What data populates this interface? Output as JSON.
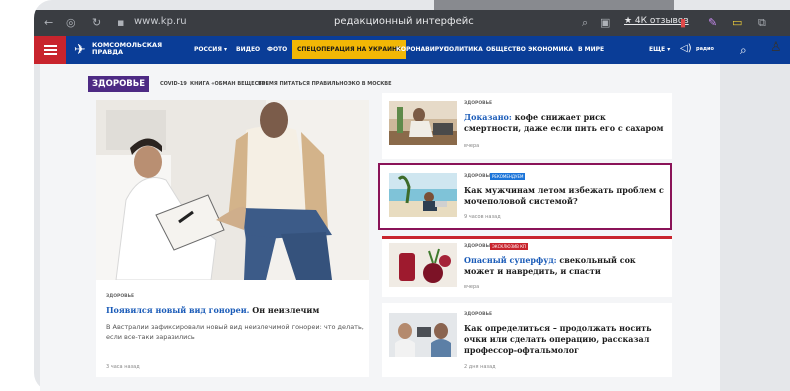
{
  "browser": {
    "url": "www.kp.ru",
    "title": "редакционный интерфейс",
    "reviews": "★ 4К отзывов"
  },
  "nav": {
    "logo": "КОМСОМОЛЬСКАЯ ПРАВДА",
    "items": [
      "РОССИЯ ▾",
      "ВИДЕО",
      "ФОТО",
      "СПЕЦОПЕРАЦИЯ НА УКРАИНЕ",
      "КОРОНАВИРУС",
      "ПОЛИТИКА",
      "ОБЩЕСТВО",
      "ЭКОНОМИКА",
      "В МИРЕ",
      "ЕЩЕ ▾"
    ],
    "radio": "радио"
  },
  "section": {
    "title": "ЗДОРОВЬЕ",
    "subnav": [
      "COVID-19",
      "КНИГА «ОБМАН ВЕЩЕСТВ»",
      "ВРЕМЯ ПИТАТЬСЯ ПРАВИЛЬНО",
      "ЭКО В МОСКВЕ"
    ]
  },
  "main_article": {
    "tag": "ЗДОРОВЬЕ",
    "headline_lead": "Появился новый вид гонореи.",
    "headline_rest": " Он неизлечим",
    "description": "В Австралии зафиксировали новый вид неизлечимой гонореи: что делать, если все-таки заразились",
    "time": "3 часа назад"
  },
  "side_articles": [
    {
      "tag": "ЗДОРОВЬЕ",
      "badge": "",
      "lead": "Доказано:",
      "rest": " кофе снижает риск смертности, даже если пить его с сахаром",
      "time": "вчера"
    },
    {
      "tag": "ЗДОРОВЬЕ",
      "badge": "РЕКОМЕНДУЕМ",
      "lead": "",
      "rest": "Как мужчинам летом избежать проблем с мочеполовой системой?",
      "time": "9 часов назад"
    },
    {
      "tag": "ЗДОРОВЬЕ",
      "badge": "ЭКСКЛЮЗИВ КП",
      "lead": "Опасный суперфуд:",
      "rest": " свекольный сок может и навредить, и спасти",
      "time": "вчера"
    },
    {
      "tag": "ЗДОРОВЬЕ",
      "badge": "",
      "lead": "",
      "rest": "Как определиться – продолжать носить очки или сделать операцию, рассказал профессор-офтальмолог",
      "time": "2 дня назад"
    }
  ],
  "colors": {
    "brand_blue": "#0a3d97",
    "brand_red": "#c8242d",
    "highlight_yellow": "#f2b705",
    "section_purple": "#4d2a84",
    "link_blue": "#1a5bb8",
    "recommend_badge": "#1b74d9",
    "exclusive_badge": "#c8242d",
    "selection_border": "#8a1358"
  }
}
